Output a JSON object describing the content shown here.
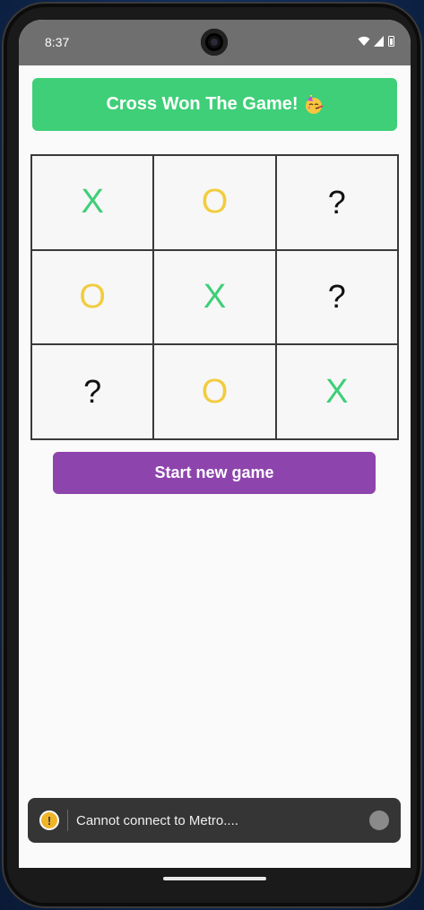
{
  "status_bar": {
    "time": "8:37"
  },
  "banner": {
    "text": "Cross Won The Game!",
    "emoji": "partying-face-emoji"
  },
  "board": {
    "cells": [
      "X",
      "O",
      "?",
      "O",
      "X",
      "?",
      "?",
      "O",
      "X"
    ]
  },
  "start_button": {
    "label": "Start new game"
  },
  "toast": {
    "message": "Cannot connect to Metro...."
  },
  "colors": {
    "banner": "#3ecf78",
    "cross": "#3ecf78",
    "nought": "#f2cc3f",
    "button": "#8e44ad",
    "toast": "#353535"
  }
}
